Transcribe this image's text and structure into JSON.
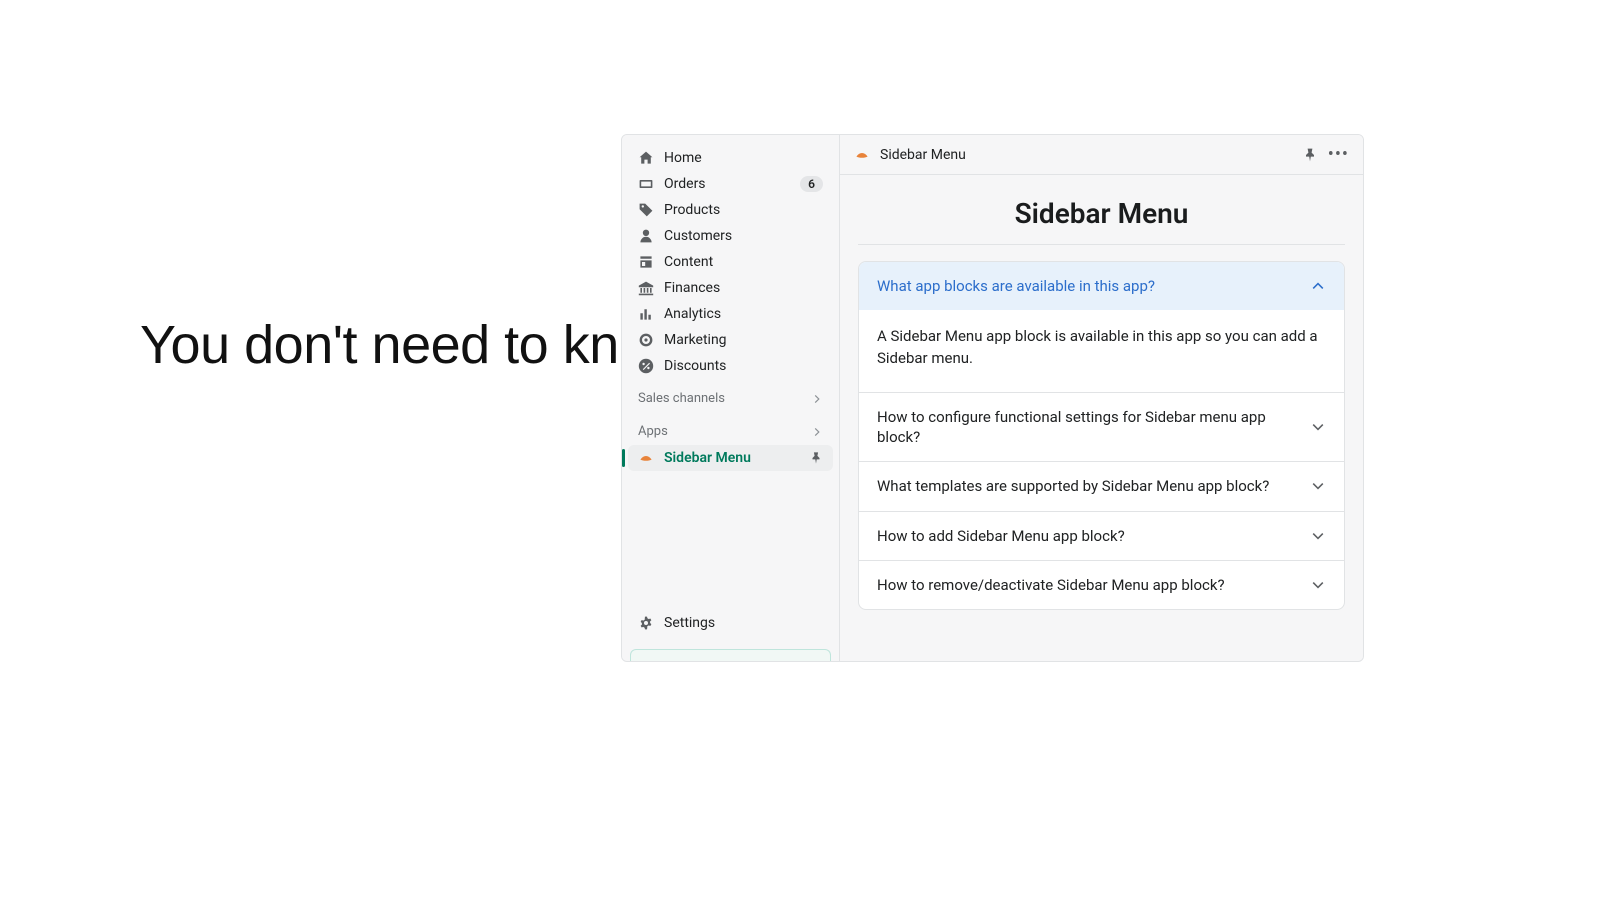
{
  "tagline": "You don't need to know programming!",
  "sidebar": {
    "items": [
      {
        "label": "Home",
        "icon": "home"
      },
      {
        "label": "Orders",
        "icon": "orders",
        "badge": "6"
      },
      {
        "label": "Products",
        "icon": "tag"
      },
      {
        "label": "Customers",
        "icon": "person"
      },
      {
        "label": "Content",
        "icon": "content"
      },
      {
        "label": "Finances",
        "icon": "bank"
      },
      {
        "label": "Analytics",
        "icon": "bars"
      },
      {
        "label": "Marketing",
        "icon": "target"
      },
      {
        "label": "Discounts",
        "icon": "discount"
      }
    ],
    "sections": {
      "sales_channels_label": "Sales channels",
      "apps_label": "Apps"
    },
    "active_app": {
      "label": "Sidebar Menu"
    },
    "settings_label": "Settings"
  },
  "topbar": {
    "title": "Sidebar Menu"
  },
  "page": {
    "title": "Sidebar Menu"
  },
  "faq": [
    {
      "question": "What app blocks are available in this app?",
      "answer": "A Sidebar Menu app block is available in this app so you can add a Sidebar menu.",
      "open": true
    },
    {
      "question": "How to configure functional settings for Sidebar menu app block?",
      "open": false
    },
    {
      "question": "What templates are supported by Sidebar Menu app block?",
      "open": false
    },
    {
      "question": "How to add Sidebar Menu app block?",
      "open": false
    },
    {
      "question": "How to remove/deactivate Sidebar Menu app block?",
      "open": false
    }
  ]
}
